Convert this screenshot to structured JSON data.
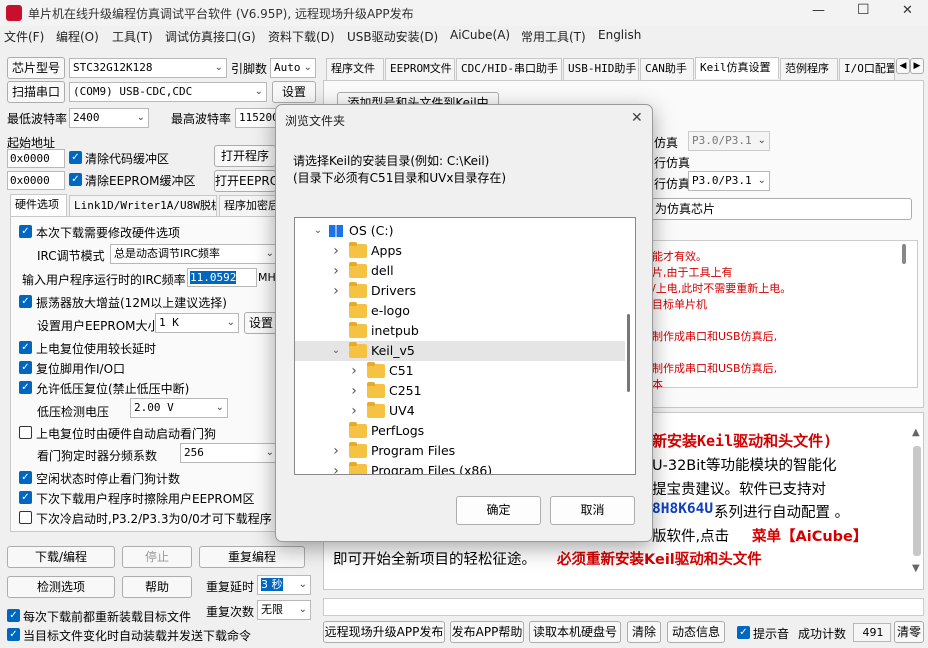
{
  "window": {
    "title": "单片机在线升级编程仿真调试平台软件 (V6.95P), 远程现场升级APP发布",
    "minimize": "—",
    "maximize": "☐",
    "close": "✕"
  },
  "menu": [
    "文件(F)",
    "编程(O)",
    "工具(T)",
    "调试仿真接口(G)",
    "资料下载(D)",
    "USB驱动安装(D)",
    "AiCube(A)",
    "常用工具(T)",
    "English"
  ],
  "left": {
    "chip_type_btn": "芯片型号",
    "chip_type_value": "STC32G12K128",
    "pin_label": "引脚数",
    "pin_value": "Auto",
    "scan_btn": "扫描串口",
    "port_value": "(COM9) USB-CDC,CDC",
    "settings_btn": "设置",
    "min_baud_label": "最低波特率",
    "min_baud_value": "2400",
    "max_baud_label": "最高波特率",
    "max_baud_value": "115200",
    "start_addr_label": "起始地址",
    "addr1": "0x0000",
    "clear_code_label": "清除代码缓冲区",
    "open_prog_btn": "打开程序",
    "addr2": "0x0000",
    "clear_eeprom_label": "清除EEPROM缓冲区",
    "open_eeprom_btn": "打开EEPRO",
    "tabs": [
      "硬件选项",
      "Link1D/Writer1A/U8W脱机",
      "程序加密后"
    ],
    "opt_modify_hw": "本次下载需要修改硬件选项",
    "irc_mode_label": "IRC调节模式",
    "irc_mode_value": "总是动态调节IRC频率",
    "irc_freq_label": "输入用户程序运行时的IRC频率",
    "irc_freq_value": "11.0592",
    "irc_unit": "MHz",
    "opt_osc_gain": "振荡器放大增益(12M以上建议选择)",
    "eeprom_size_label": "设置用户EEPROM大小",
    "eeprom_size_value": "1    K",
    "eeprom_set_btn": "设置",
    "opt_long_reset": "上电复位使用较长延时",
    "opt_reset_io": "复位脚用作I/O口",
    "opt_lvr": "允许低压复位(禁止低压中断)",
    "lv_label": "低压检测电压",
    "lv_value": "2.00 V",
    "opt_wdt": "上电复位时由硬件自动启动看门狗",
    "wdt_div_label": "看门狗定时器分频系数",
    "wdt_div_value": "256",
    "opt_idle_wdt": "空闲状态时停止看门狗计数",
    "opt_erase_eeprom": "下次下载用户程序时擦除用户EEPROM区",
    "opt_p32_p33": "下次冷启动时,P3.2/P3.3为0/0才可下载程序",
    "download_btn": "下载/编程",
    "stop_btn": "停止",
    "reprogram_btn": "重复编程",
    "check_btn": "检测选项",
    "help_btn": "帮助",
    "repeat_delay_label": "重复延时",
    "repeat_delay_value": "3 秒",
    "repeat_count_label": "重复次数",
    "repeat_count_value": "无限",
    "opt_reload": "每次下载前都重新装载目标文件",
    "opt_auto_send": "当目标文件变化时自动装载并发送下载命令"
  },
  "right": {
    "tabs": [
      "程序文件",
      "EEPROM文件",
      "CDC/HID-串口助手",
      "USB-HID助手",
      "CAN助手",
      "Keil仿真设置",
      "范例程序",
      "I/O口配置"
    ],
    "add_btn": "添加型号和头文件到Keil中",
    "sim_label1": "仿真",
    "sim_value1": "P3.0/P3.1",
    "sim_label2": "行仿真",
    "sim_label3": "行仿真",
    "sim_value3": "P3.0/P3.1",
    "set_chip_btn": "为仿真芯片",
    "info_lines": [
      "能才有效。",
      "片,由于工具上有",
      "/上电,此时不需要重新上电。",
      "目标单片机",
      "",
      "制作成串口和USB仿真后,",
      "",
      "制作成串口和USB仿真后,",
      "本"
    ],
    "news_line1": "新安装Keil驱动和头文件)",
    "news_line2": "U-32Bit等功能模块的智能化",
    "news_line3": "提宝贵建议。软件已支持对",
    "news_line4a": "8H8K64U",
    "news_line4b": "系列进行自动配置 。",
    "news_line5a": "版软件,点击",
    "news_line5b": "菜单【AiCube】",
    "news_line6a": "即可开始全新项目的轻松征途。",
    "news_line6b": "必须重新安装Keil驱动和头文件"
  },
  "bottom": {
    "remote_btn": "远程现场升级APP发布",
    "app_help_btn": "发布APP帮助",
    "read_disk_btn": "读取本机硬盘号",
    "clear_btn": "清除",
    "dynamic_btn": "动态信息",
    "beep_label": "提示音",
    "success_label": "成功计数",
    "success_value": "491",
    "clear_count_btn": "清零"
  },
  "dialog": {
    "title": "浏览文件夹",
    "instruction1": "请选择Keil的安装目录(例如: C:\\Keil)",
    "instruction2": "(目录下必须有C51目录和UVx目录存在)",
    "ok_btn": "确定",
    "cancel_btn": "取消",
    "tree": [
      {
        "label": "OS (C:)",
        "level": 0,
        "expanded": true,
        "drive": true
      },
      {
        "label": "Apps",
        "level": 1,
        "expanded": false
      },
      {
        "label": "dell",
        "level": 1,
        "expanded": false
      },
      {
        "label": "Drivers",
        "level": 1,
        "expanded": false
      },
      {
        "label": "e-logo",
        "level": 1,
        "leaf": true
      },
      {
        "label": "inetpub",
        "level": 1,
        "leaf": true
      },
      {
        "label": "Keil_v5",
        "level": 1,
        "expanded": true,
        "selected": true
      },
      {
        "label": "C51",
        "level": 2,
        "expanded": false
      },
      {
        "label": "C251",
        "level": 2,
        "expanded": false
      },
      {
        "label": "UV4",
        "level": 2,
        "expanded": false
      },
      {
        "label": "PerfLogs",
        "level": 1,
        "leaf": true
      },
      {
        "label": "Program Files",
        "level": 1,
        "expanded": false
      },
      {
        "label": "Program Files (x86)",
        "level": 1,
        "expanded": false
      }
    ]
  }
}
